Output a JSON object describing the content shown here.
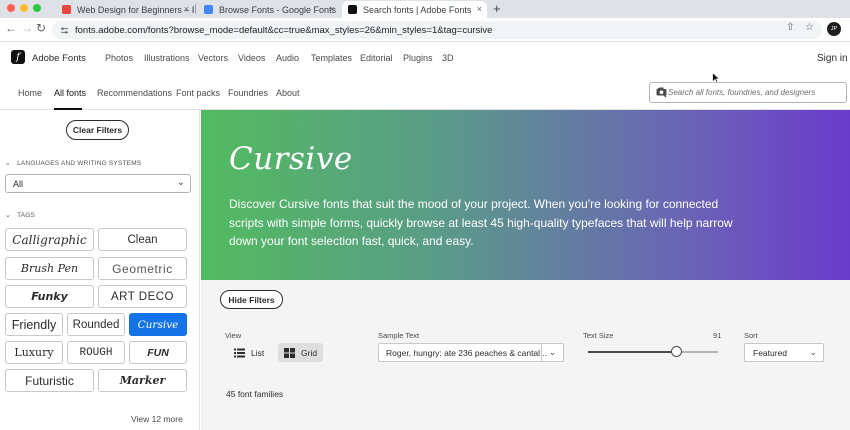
{
  "browser": {
    "tabs": [
      {
        "title": "Web Design for Beginners – Fi...",
        "favicon_color": "#e8453c",
        "active": false
      },
      {
        "title": "Browse Fonts - Google Fonts",
        "favicon_color": "#4285f4",
        "active": false
      },
      {
        "title": "Search fonts | Adobe Fonts",
        "favicon_color": "#111111",
        "active": true
      }
    ],
    "close_glyph": "×",
    "new_tab_glyph": "+",
    "url": "fonts.adobe.com/fonts?browse_mode=default&cc=true&max_styles=26&min_styles=1&tag=cursive",
    "profile_initials": "JP"
  },
  "header": {
    "logo_letter": "f",
    "brand": "Adobe Fonts",
    "nav": [
      "Photos",
      "Illustrations",
      "Vectors",
      "Videos",
      "Audio",
      "Templates",
      "Editorial",
      "Plugins",
      "3D"
    ],
    "signin": "Sign in"
  },
  "subnav": {
    "items": [
      "Home",
      "All fonts",
      "Recommendations",
      "Font packs",
      "Foundries",
      "About"
    ],
    "active": "All fonts",
    "search_placeholder": "Search all fonts, foundries, and designers"
  },
  "sidebar": {
    "clear_filters": "Clear Filters",
    "languages_label": "LANGUAGES AND WRITING SYSTEMS",
    "language_value": "All",
    "tags_label": "TAGS",
    "tags": [
      "Calligraphic",
      "Clean",
      "Brush Pen",
      "Geometric",
      "Funky",
      "Art Deco",
      "Friendly",
      "Rounded",
      "Cursive",
      "Luxury",
      "Rough",
      "Fun",
      "Futuristic",
      "Marker"
    ],
    "active_tag": "Cursive",
    "view_more": "View 12 more"
  },
  "hero": {
    "title": "Cursive",
    "description": "Discover Cursive fonts that suit the mood of your project. When you're looking for connected scripts with simple forms, quickly browse at least 45 high-quality typefaces that will help narrow down your font selection fast, quick, and easy."
  },
  "filters": {
    "hide_filters": "Hide Filters",
    "view_label": "View",
    "view_list": "List",
    "view_grid": "Grid",
    "view_active": "Grid",
    "sample_label": "Sample Text",
    "sample_value": "Roger, hungry: ate 236 peaches & cantal...",
    "size_label": "Text Size",
    "size_value": "91",
    "size_slider_fraction": 0.68,
    "sort_label": "Sort",
    "sort_value": "Featured",
    "result_count": "45 font families"
  },
  "colors": {
    "accent_blue": "#1473e6",
    "hero_start": "#52bb5f",
    "hero_end": "#6a3bcb"
  }
}
